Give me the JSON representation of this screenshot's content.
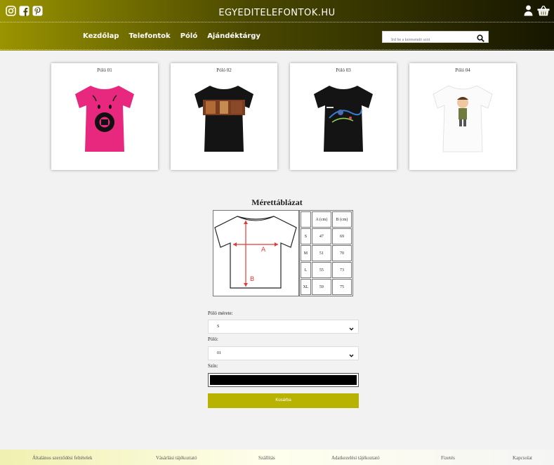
{
  "header": {
    "site_title": "EGYEDITELEFONTOK.HU",
    "nav": [
      "Kezdőlap",
      "Telefontok",
      "Póló",
      "Ajándéktárgy"
    ],
    "search_placeholder": "Írd be a keresendő szót"
  },
  "products": [
    {
      "title": "Póló 01",
      "shirt_color": "#e8287e"
    },
    {
      "title": "Póló 02",
      "shirt_color": "#111111"
    },
    {
      "title": "Póló 03",
      "shirt_color": "#111111"
    },
    {
      "title": "Póló 04",
      "shirt_color": "#ffffff"
    }
  ],
  "size_chart": {
    "title": "Mérettáblázat",
    "measure_a": "A",
    "measure_b": "B",
    "headers": [
      "",
      "A (cm)",
      "B (cm)"
    ],
    "rows": [
      [
        "S",
        "47",
        "69"
      ],
      [
        "M",
        "51",
        "70"
      ],
      [
        "L",
        "55",
        "73"
      ],
      [
        "XL",
        "59",
        "75"
      ]
    ]
  },
  "form": {
    "size_label": "Póló mérete:",
    "size_value": "S",
    "shirt_label": "Póló:",
    "shirt_value": "01",
    "color_label": "Szín:",
    "color_value": "#000000",
    "cart_button": "Kosárba"
  },
  "footer": [
    "Általános szerződési feltételek",
    "Vásárlási tájékoztató",
    "Szállítás",
    "Adatkezelési tájékoztató",
    "Fizetés",
    "Kapcsolat"
  ],
  "colors": {
    "accent": "#b8b300",
    "header_dark": "#161600"
  }
}
